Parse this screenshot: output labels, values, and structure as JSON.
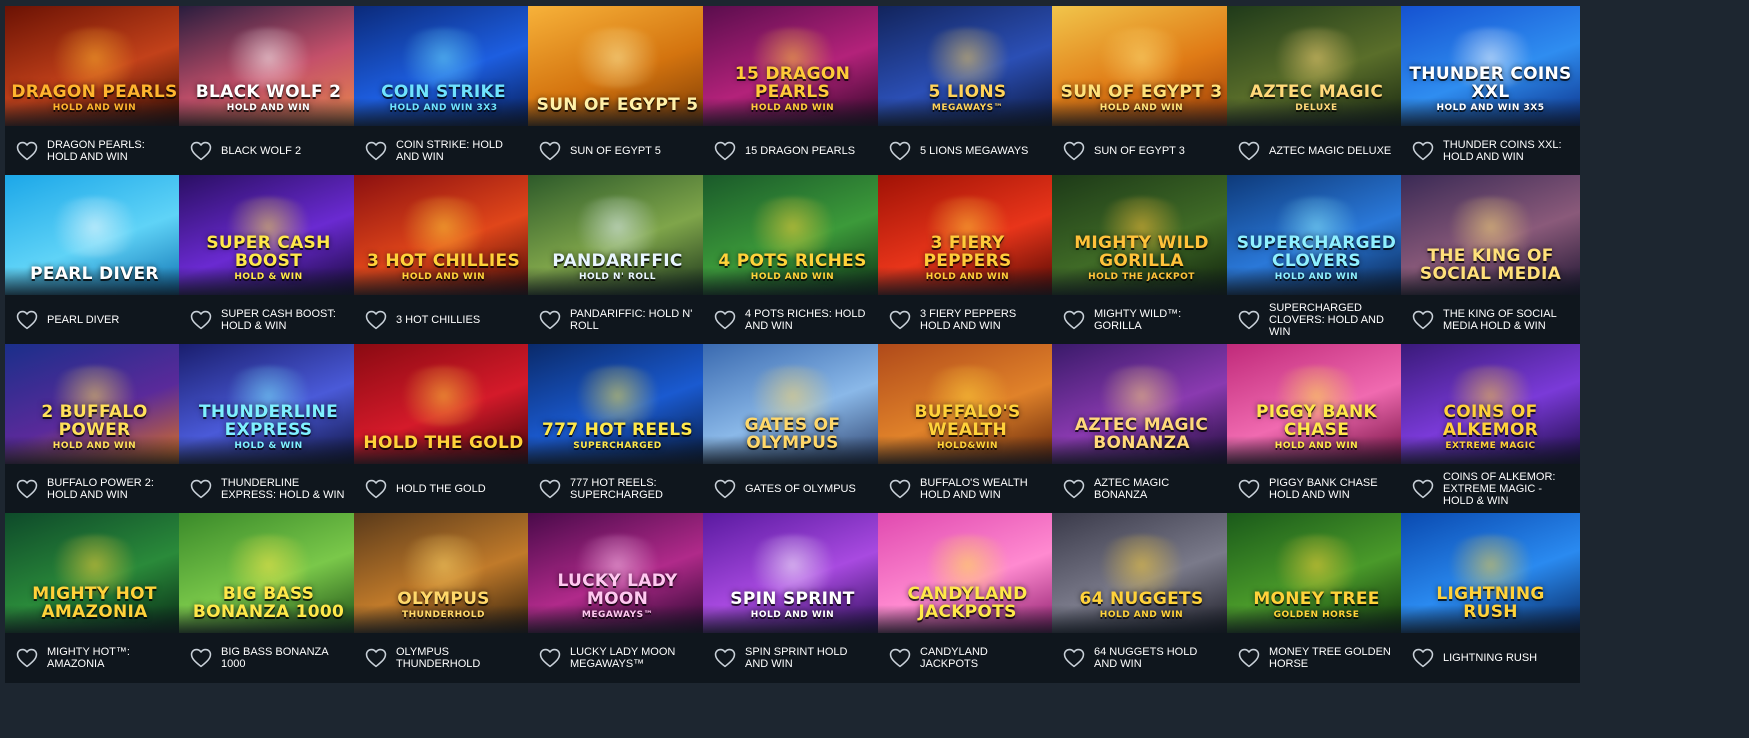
{
  "colors": {
    "page_bg": "#1d2630",
    "card_bg": "#0f161d",
    "text": "#ffffff",
    "heart_outline": "#c9d1d9"
  },
  "favorite_icon": "heart-outline-icon",
  "games": [
    {
      "name": "DRAGON PEARLS: HOLD AND WIN",
      "art_title": "DRAGON PEARLS",
      "art_sub": "HOLD AND WIN",
      "bg": [
        "#6b1204",
        "#c2411a",
        "#2a0700"
      ],
      "title_color": "#ffb52e"
    },
    {
      "name": "BLACK WOLF 2",
      "art_title": "BLACK WOLF 2",
      "art_sub": "HOLD AND WIN",
      "bg": [
        "#2a1d3e",
        "#c4506a",
        "#e98a4a"
      ],
      "title_color": "#ffffff"
    },
    {
      "name": "COIN STRIKE: HOLD AND WIN",
      "art_title": "COIN STRIKE",
      "art_sub": "HOLD AND WIN 3x3",
      "bg": [
        "#0b2a7a",
        "#1d5ee0",
        "#061a52"
      ],
      "title_color": "#6fe3ff"
    },
    {
      "name": "SUN OF EGYPT 5",
      "art_title": "SUN OF EGYPT 5",
      "art_sub": "",
      "bg": [
        "#f7b23a",
        "#d4740f",
        "#7a3a05"
      ],
      "title_color": "#fff1a8"
    },
    {
      "name": "15 DRAGON PEARLS",
      "art_title": "15 DRAGON PEARLS",
      "art_sub": "HOLD AND WIN",
      "bg": [
        "#5a0d4d",
        "#b3227a",
        "#2a0524"
      ],
      "title_color": "#ffcb3a"
    },
    {
      "name": "5 LIONS MEGAWAYS",
      "art_title": "5 LIONS",
      "art_sub": "MEGAWAYS™",
      "bg": [
        "#12245c",
        "#2b4fb5",
        "#0a1538"
      ],
      "title_color": "#ffd35a"
    },
    {
      "name": "SUN OF EGYPT 3",
      "art_title": "SUN OF EGYPT 3",
      "art_sub": "HOLD AND WIN",
      "bg": [
        "#f1c54b",
        "#e07b16",
        "#9a3a06"
      ],
      "title_color": "#ffe27a"
    },
    {
      "name": "AZTEC MAGIC DELUXE",
      "art_title": "AZTEC MAGIC",
      "art_sub": "DELUXE",
      "bg": [
        "#1f3a1a",
        "#5a6e2a",
        "#152410"
      ],
      "title_color": "#ffd97a"
    },
    {
      "name": "THUNDER COINS XXL: HOLD AND WIN",
      "art_title": "THUNDER COINS XXL",
      "art_sub": "HOLD AND WIN 3x5",
      "bg": [
        "#1552d1",
        "#2f8df0",
        "#0b2f86"
      ],
      "title_color": "#ffffff"
    },
    {
      "name": "PEARL DIVER",
      "art_title": "PEARL DIVER",
      "art_sub": "",
      "bg": [
        "#1ca7e8",
        "#5fd3f7",
        "#0d6fb0"
      ],
      "title_color": "#ffffff"
    },
    {
      "name": "SUPER CASH BOOST: HOLD & WIN",
      "art_title": "SUPER CASH BOOST",
      "art_sub": "HOLD & WIN",
      "bg": [
        "#2a0f63",
        "#6a2ad1",
        "#140733"
      ],
      "title_color": "#ffe84a"
    },
    {
      "name": "3 HOT CHILLIES",
      "art_title": "3 HOT CHILLIES",
      "art_sub": "HOLD AND WIN",
      "bg": [
        "#8c1010",
        "#e0461a",
        "#3e0505"
      ],
      "title_color": "#ffd23a"
    },
    {
      "name": "PANDARIFFIC: HOLD N' ROLL",
      "art_title": "PANDARIFFIC",
      "art_sub": "HOLD N' ROLL",
      "bg": [
        "#2d5a2a",
        "#7fa54a",
        "#19331a"
      ],
      "title_color": "#e8f5ff"
    },
    {
      "name": "4 POTS RICHES: HOLD AND WIN",
      "art_title": "4 POTS RICHES",
      "art_sub": "HOLD AND WIN",
      "bg": [
        "#1a5a2a",
        "#3c9a3a",
        "#0c2f14"
      ],
      "title_color": "#ffd23a"
    },
    {
      "name": "3 FIERY PEPPERS HOLD AND WIN",
      "art_title": "3 FIERY PEPPERS",
      "art_sub": "HOLD AND WIN",
      "bg": [
        "#a01206",
        "#e8351a",
        "#4a0602"
      ],
      "title_color": "#ffcc3a"
    },
    {
      "name": "MIGHTY WILD™: GORILLA",
      "art_title": "MIGHTY WILD GORILLA",
      "art_sub": "HOLD THE JACKPOT",
      "bg": [
        "#1d3a18",
        "#3f6a26",
        "#0e1f0c"
      ],
      "title_color": "#ffc23a"
    },
    {
      "name": "SUPERCHARGED CLOVERS: HOLD AND WIN",
      "art_title": "SUPERCHARGED CLOVERS",
      "art_sub": "HOLD AND WIN",
      "bg": [
        "#0e3a7a",
        "#2a78d8",
        "#071f45"
      ],
      "title_color": "#8ff0ff"
    },
    {
      "name": "THE KING OF SOCIAL MEDIA HOLD & WIN",
      "art_title": "THE KING OF SOCIAL MEDIA",
      "art_sub": "",
      "bg": [
        "#3a2a55",
        "#8a5a7a",
        "#1c1430"
      ],
      "title_color": "#ffe07a"
    },
    {
      "name": "BUFFALO POWER 2: HOLD AND WIN",
      "art_title": "2 BUFFALO POWER",
      "art_sub": "HOLD AND WIN",
      "bg": [
        "#1a2f8a",
        "#5a2a9a",
        "#e0751a"
      ],
      "title_color": "#ffe05a"
    },
    {
      "name": "THUNDERLINE EXPRESS: HOLD & WIN",
      "art_title": "THUNDERLINE EXPRESS",
      "art_sub": "HOLD & WIN",
      "bg": [
        "#1a1e6e",
        "#4a5ad8",
        "#0c0f38"
      ],
      "title_color": "#7ff0ff"
    },
    {
      "name": "HOLD THE GOLD",
      "art_title": "HOLD THE GOLD",
      "art_sub": "",
      "bg": [
        "#8a0a12",
        "#d41a2a",
        "#3e0308"
      ],
      "title_color": "#ffd23a"
    },
    {
      "name": "777 HOT REELS: SUPERCHARGED",
      "art_title": "777 HOT REELS",
      "art_sub": "SUPERCHARGED",
      "bg": [
        "#0a2a6a",
        "#1a5ad0",
        "#061738"
      ],
      "title_color": "#ffe84a"
    },
    {
      "name": "GATES OF OLYMPUS",
      "art_title": "GATES OF OLYMPUS",
      "art_sub": "",
      "bg": [
        "#3a6ab0",
        "#8ab8e8",
        "#2a3e6a"
      ],
      "title_color": "#ffd86a"
    },
    {
      "name": "BUFFALO'S WEALTH HOLD AND WIN",
      "art_title": "BUFFALO'S WEALTH",
      "art_sub": "HOLD&WIN",
      "bg": [
        "#b04a1a",
        "#e0822a",
        "#5a1f08"
      ],
      "title_color": "#ffd23a"
    },
    {
      "name": "AZTEC MAGIC BONANZA",
      "art_title": "AZTEC MAGIC BONANZA",
      "art_sub": "",
      "bg": [
        "#3a1a6a",
        "#8a3ab0",
        "#1a0a35"
      ],
      "title_color": "#ffd97a"
    },
    {
      "name": "PIGGY BANK CHASE HOLD AND WIN",
      "art_title": "PIGGY BANK CHASE",
      "art_sub": "HOLD AND WIN",
      "bg": [
        "#c02a7a",
        "#f06ab0",
        "#6a0a3a"
      ],
      "title_color": "#ffe84a"
    },
    {
      "name": "COINS OF ALKEMOR: EXTREME MAGIC - HOLD & WIN",
      "art_title": "COINS OF ALKEMOR",
      "art_sub": "EXTREME MAGIC",
      "bg": [
        "#3a1a7a",
        "#7a3ad8",
        "#1a0a40"
      ],
      "title_color": "#ffd23a"
    },
    {
      "name": "MIGHTY HOT™: AMAZONIA",
      "art_title": "MIGHTY HOT AMAZONIA",
      "art_sub": "",
      "bg": [
        "#0e4a2a",
        "#2a8a3a",
        "#062614"
      ],
      "title_color": "#ffd23a"
    },
    {
      "name": "BIG BASS BONANZA 1000",
      "art_title": "BIG BASS BONANZA 1000",
      "art_sub": "",
      "bg": [
        "#3a8a2a",
        "#7ac84a",
        "#1a4a14"
      ],
      "title_color": "#ffe84a"
    },
    {
      "name": "OLYMPUS THUNDERHOLD",
      "art_title": "OLYMPUS",
      "art_sub": "THUNDERHOLD",
      "bg": [
        "#5a3a1a",
        "#c07a2a",
        "#2a1a0a"
      ],
      "title_color": "#ffd86a"
    },
    {
      "name": "LUCKY LADY MOON MEGAWAYS™",
      "art_title": "Lucky Lady Moon",
      "art_sub": "MEGAWAYS™",
      "bg": [
        "#4a0a4a",
        "#b02a8a",
        "#22052a"
      ],
      "title_color": "#ffc8f0"
    },
    {
      "name": "SPIN SPRINT HOLD AND WIN",
      "art_title": "SPIN SPRINT",
      "art_sub": "HOLD AND WIN",
      "bg": [
        "#5a1aa0",
        "#a84ae0",
        "#2a0a55"
      ],
      "title_color": "#ffffff"
    },
    {
      "name": "CANDYLAND JACKPOTS",
      "art_title": "CANDYLAND JACKPOTS",
      "art_sub": "",
      "bg": [
        "#e04ab0",
        "#ff8ad0",
        "#8a1a6a"
      ],
      "title_color": "#ffe84a"
    },
    {
      "name": "64 NUGGETS HOLD AND WIN",
      "art_title": "64 NUGGETS",
      "art_sub": "HOLD AND WIN",
      "bg": [
        "#3a3a4a",
        "#7a7a8a",
        "#1a1a24"
      ],
      "title_color": "#ffd23a"
    },
    {
      "name": "MONEY TREE GOLDEN HORSE",
      "art_title": "MONEY TREE",
      "art_sub": "GOLDEN HORSE",
      "bg": [
        "#1a5a1a",
        "#4a9a2a",
        "#0a2a0a"
      ],
      "title_color": "#ffd23a"
    },
    {
      "name": "LIGHTNING RUSH",
      "art_title": "LIGHTNING RUSH",
      "art_sub": "",
      "bg": [
        "#0a4ab0",
        "#2a8af0",
        "#06245a"
      ],
      "title_color": "#ffd23a"
    }
  ]
}
